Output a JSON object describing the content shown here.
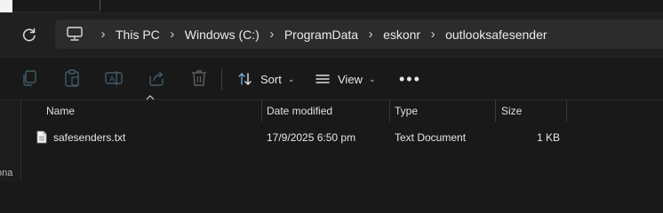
{
  "breadcrumb": {
    "items": [
      "This PC",
      "Windows (C:)",
      "ProgramData",
      "eskonr",
      "outlooksafesender"
    ],
    "separator": "›"
  },
  "toolbar": {
    "sort_label": "Sort",
    "view_label": "View",
    "more_label": "•••"
  },
  "columns": {
    "name": "Name",
    "date_modified": "Date modified",
    "type": "Type",
    "size": "Size"
  },
  "files": [
    {
      "name": "safesenders.txt",
      "date_modified": "17/9/2025 6:50 pm",
      "type": "Text Document",
      "size": "1 KB",
      "icon": "text-file-icon"
    }
  ],
  "left_pane": {
    "partial_text": "ona"
  },
  "colors": {
    "background": "#191919",
    "address_bar": "#2c2c2c",
    "nav_bar": "#202020",
    "text": "#e6e6e6"
  }
}
